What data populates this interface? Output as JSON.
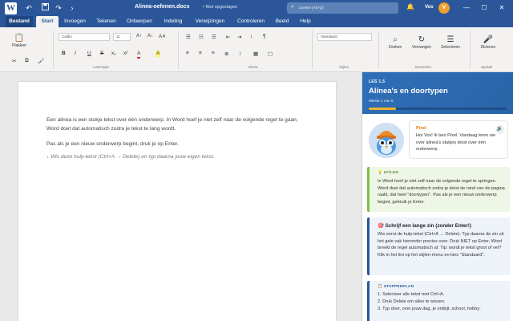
{
  "titlebar": {
    "logo": "W",
    "undo_icon": "↶",
    "save_icon": "💾",
    "redo_icon": "↷",
    "filename": "Alinea-oefenen.docx",
    "status": "• Niet opgeslagen",
    "search_placeholder": "Zoeken (Alt+Q)",
    "user": "Vos",
    "avatar_initial": "V",
    "minimize": "—",
    "maximize": "☐",
    "close": "✕"
  },
  "tabs": [
    {
      "label": "Bestand"
    },
    {
      "label": "Start"
    },
    {
      "label": "Invoegen"
    },
    {
      "label": "Tekenen"
    },
    {
      "label": "Ontwerpen"
    },
    {
      "label": "Indeling"
    },
    {
      "label": "Verwijzingen"
    },
    {
      "label": "Controleren"
    },
    {
      "label": "Beeld"
    },
    {
      "label": "Help"
    }
  ],
  "ribbon": {
    "paste_label": "Plakken",
    "font_name": "Calibri",
    "font_size": "11",
    "style_value": "Standaard",
    "groups": {
      "clipboard": "",
      "font": "Lettertype",
      "paragraph": "Alinea",
      "styles": "Stijlen",
      "editing": "Bewerken",
      "voice": "Spraak"
    },
    "buttons": {
      "bold": "B",
      "italic": "I",
      "underline": "U",
      "strike": "S",
      "sub": "x₂",
      "sup": "x²",
      "font_color": "A",
      "highlight": "A",
      "search": "Zoeken",
      "replace": "Vervangen",
      "select": "Selecteren",
      "dictate": "Dicteren"
    }
  },
  "document": {
    "paragraph1": "Een alinea is een stukje tekst over één onderwerp. In Word hoef je niet zelf naar de volgende regel te gaan, Word doet dat automatisch zodra je tekst te lang wordt.",
    "paragraph2": "Pas als je een nieuw onderwerp begint, druk je op Enter.",
    "hint": "↓ Wis deze hulp-tekst (Ctrl+A → Delete) en typ daarna jouw eigen tekst."
  },
  "panel": {
    "lesson": "LES 1.5",
    "title": "Alinea's en doortypen",
    "mission": "Missie 1 van 5",
    "progress": 0.2,
    "pixel": {
      "name": "Pixel",
      "message": "Hoi Vos! Ik ben Pixel. Vandaag leren we over alinea's stukjes tekst over één onderwerp."
    },
    "uitleg": {
      "label": "💡 UITLEG",
      "body": "In Word hoef je niet zelf naar de volgende regel te springen. Word doet dat automatisch zodra je tekst de rand van de pagina raakt, dat heet \"doortypen\". Pas als je een nieuw onderwerp begint, gebruik je Enter."
    },
    "opdracht": {
      "title": "🎯 Schrijf een lange zin (zonder Enter!)",
      "body": "Wis eerst de hulp-tekst (Ctrl+A → Delete). Typ daarna de zin uit het gele vak hieronder precies over. Druk NIET op Enter, Word breekt de regel automatisch af. Tip: wordt je tekst groot of vet? Klik in het lint op het stijlen-menu en kies \"Standaard\"."
    },
    "stappen": {
      "label": "📋 STAPPENPLAN",
      "steps": [
        "1. Selecteer alle tekst met Ctrl+A.",
        "2. Druk Delete om alles te wissen.",
        "3. Typ door, over jouw dag, je ontbijt, school, hobby:"
      ]
    }
  },
  "colors": {
    "brand": "#2b579a",
    "accent": "#f0a030",
    "tip_green": "#7bbf4a"
  }
}
